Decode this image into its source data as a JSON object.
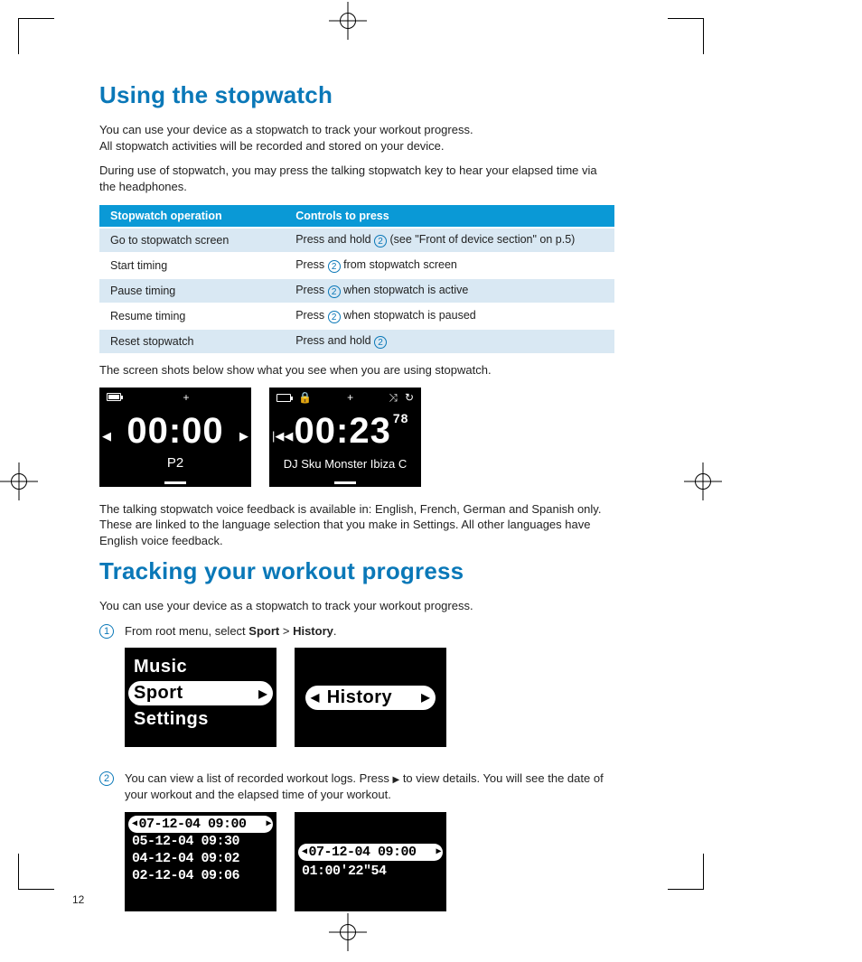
{
  "page_number": "12",
  "heading1": "Using the stopwatch",
  "intro_line1": "You can use your device as a stopwatch to track your workout progress.",
  "intro_line2": "All stopwatch activities will be recorded and stored on your device.",
  "intro_para2": "During use of stopwatch, you may press the talking stopwatch key to hear your elapsed time via the headphones.",
  "table": {
    "header_op": "Stopwatch operation",
    "header_ctrl": "Controls to press",
    "rows": [
      {
        "op": "Go to stopwatch screen",
        "pre": "Press and hold ",
        "key": "2",
        "post": " (see \"Front of device section\" on p.5)"
      },
      {
        "op": "Start timing",
        "pre": "Press ",
        "key": "2",
        "post": " from stopwatch screen"
      },
      {
        "op": "Pause timing",
        "pre": "Press ",
        "key": "2",
        "post": " when stopwatch is active"
      },
      {
        "op": "Resume timing",
        "pre": "Press ",
        "key": "2",
        "post": " when stopwatch is paused"
      },
      {
        "op": "Reset stopwatch",
        "pre": "Press and hold ",
        "key": "2",
        "post": ""
      }
    ]
  },
  "screenshots_intro": "The screen shots below show what you see when you are using stopwatch.",
  "screen_a": {
    "time": "00:00",
    "label": "P2",
    "plus": "+"
  },
  "screen_b": {
    "time": "00:23",
    "hundredths": "78",
    "track": "DJ Sku Monster Ibiza C",
    "plus": "+",
    "shuffle": "⤨",
    "repeat": "↻"
  },
  "voice_note": "The talking stopwatch voice feedback is available in: English, French, German and Spanish only. These are linked to the language selection that you make in Settings. All other languages have English voice feedback.",
  "heading2": "Tracking your workout progress",
  "track_intro": "You can use your device as a stopwatch to track your workout progress.",
  "step1": {
    "num": "1",
    "pre": "From root menu, select ",
    "b1": "Sport",
    "gt": " > ",
    "b2": "History",
    "dot": ".",
    "menu": {
      "m1": "Music",
      "m2": "Sport",
      "m3": "Settings"
    },
    "screen2": "History"
  },
  "step2": {
    "num": "2",
    "line": "You can view a list of recorded workout logs.  Press ",
    "line_post": " to view details.  You will see the date of your workout and the elapsed time of your workout.",
    "logs": [
      "07-12-04 09:00",
      "05-12-04 09:30",
      "04-12-04 09:02",
      "02-12-04 09:06"
    ],
    "detail_date": "07-12-04 09:00",
    "detail_time": "01:00'22\"54"
  }
}
